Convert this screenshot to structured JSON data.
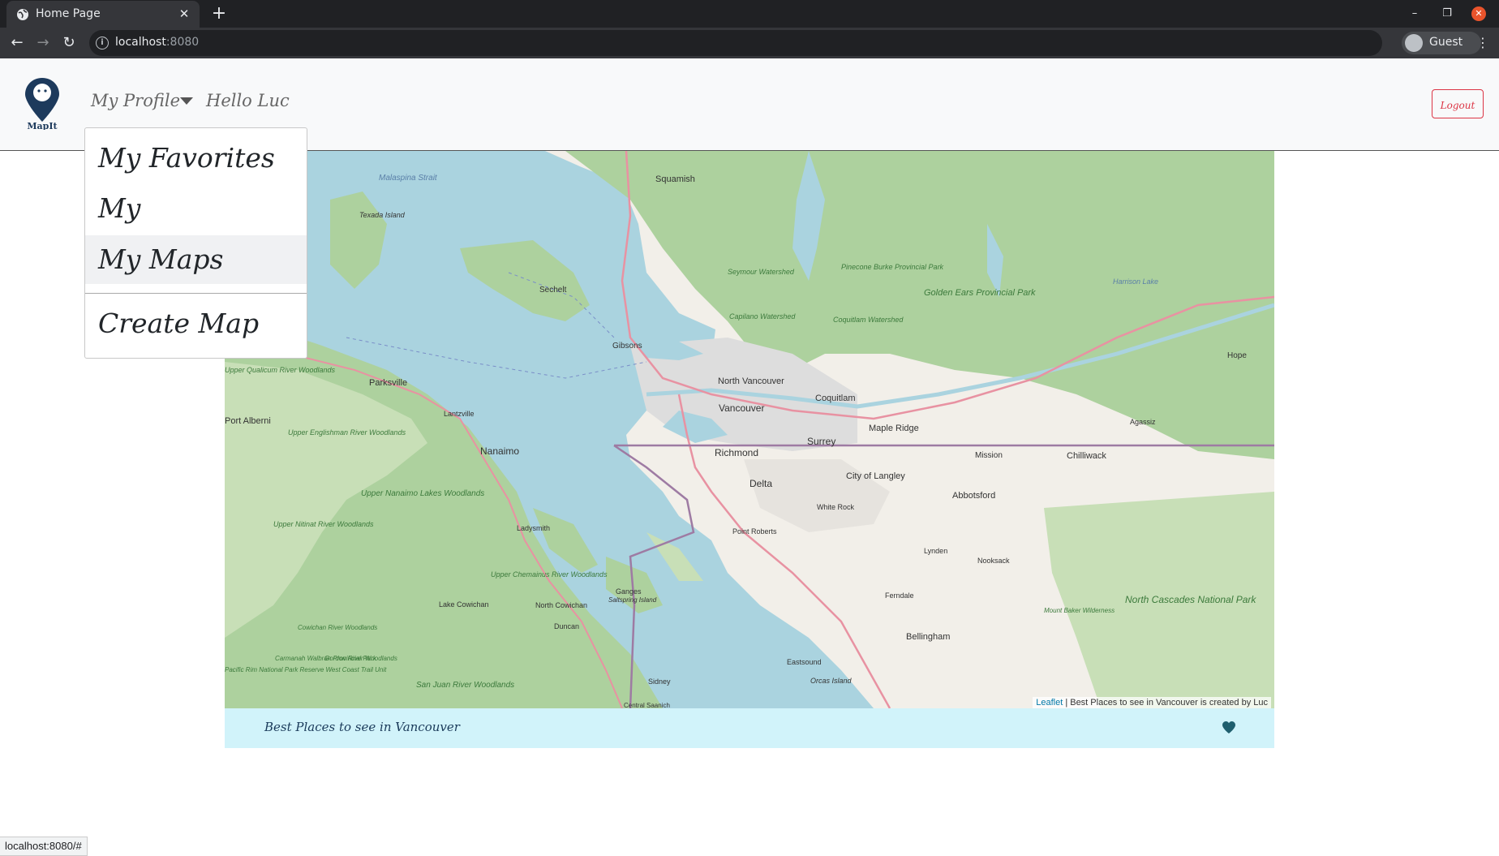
{
  "browser": {
    "tab_title": "Home Page",
    "url_host": "localhost",
    "url_port": ":8080",
    "profile_label": "Guest",
    "status_url": "localhost:8080/#"
  },
  "navbar": {
    "brand": "MapIt",
    "profile_label": "My Profile",
    "greeting": "Hello Luc",
    "logout_label": "Logout"
  },
  "dropdown": {
    "items": [
      {
        "label": "My Favorites"
      },
      {
        "label": "My Contributions"
      },
      {
        "label": "My Maps"
      },
      {
        "label": "Create Map"
      }
    ]
  },
  "map": {
    "place_labels": [
      "Squamish",
      "Malaspina Strait",
      "Texada Island",
      "Sechelt",
      "Gibsons",
      "Seymour Watershed",
      "Capilano Watershed",
      "Pinecone Burke Provincial Park",
      "Coquitlam Watershed",
      "Golden Ears Provincial Park",
      "Harrison Lake",
      "Hope",
      "Upper Qualicum River Woodlands",
      "Parksville",
      "Port Alberni",
      "Lantzville",
      "North Vancouver",
      "Coquitlam",
      "Vancouver",
      "Maple Ridge",
      "Agassiz",
      "Upper Englishman River Woodlands",
      "Nanaimo",
      "Richmond",
      "Surrey",
      "Mission",
      "Chilliwack",
      "City of Langley",
      "Abbotsford",
      "Delta",
      "White Rock",
      "Upper Nanaimo Lakes Woodlands",
      "Upper Nitinat River Woodlands",
      "Ladysmith",
      "Point Roberts",
      "Lynden",
      "Nooksack",
      "Upper Chemainus River Woodlands",
      "Ganges",
      "Saltspring Island",
      "Lake Cowichan",
      "North Cowichan",
      "Ferndale",
      "North Cascades National Park",
      "Mount Baker Wilderness",
      "Duncan",
      "Cowichan River Woodlands",
      "Bellingham",
      "Carmanah Walbran Provincial Park",
      "Gordon River Woodlands",
      "Pacific Rim National Park Reserve West Coast Trail Unit",
      "Eastsound",
      "Orcas Island",
      "San Juan River Woodlands",
      "Sidney",
      "Central Saanich"
    ],
    "attribution_leaflet": "Leaflet",
    "attribution_text": "| Best Places to see in Vancouver is created by Luc",
    "title": "Best Places to see in Vancouver"
  },
  "colors": {
    "water": "#aad3df",
    "land": "#f2efe9",
    "forest": "#add19e",
    "wood": "#c8dfb7",
    "urban": "#dddddd",
    "motorway": "#e892a2",
    "border": "#9e7ba3",
    "footer_bg": "#d1f3fa",
    "logout": "#dc3545"
  }
}
